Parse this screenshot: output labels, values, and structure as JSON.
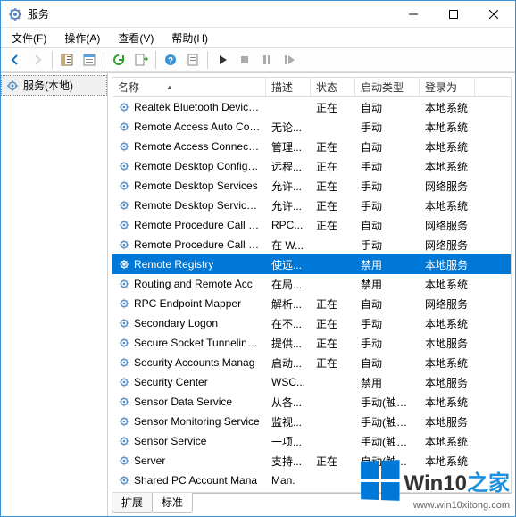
{
  "title": "服务",
  "menus": {
    "file": "文件(F)",
    "action": "操作(A)",
    "view": "查看(V)",
    "help": "帮助(H)"
  },
  "tree": {
    "root": "服务(本地)"
  },
  "columns": {
    "name": "名称",
    "desc": "描述",
    "status": "状态",
    "start": "启动类型",
    "logon": "登录为"
  },
  "tabs": {
    "extended": "扩展",
    "standard": "标准"
  },
  "watermark": {
    "brand_main": "Win10",
    "brand_suffix": "之家",
    "url": "www.win10xitong.com"
  },
  "services": [
    {
      "name": "Realtek Bluetooth Device...",
      "desc": "",
      "status": "正在",
      "start": "自动",
      "logon": "本地系统"
    },
    {
      "name": "Remote Access Auto Con...",
      "desc": "无论...",
      "status": "",
      "start": "手动",
      "logon": "本地系统"
    },
    {
      "name": "Remote Access Connecti...",
      "desc": "管理...",
      "status": "正在",
      "start": "自动",
      "logon": "本地系统"
    },
    {
      "name": "Remote Desktop Configu...",
      "desc": "远程...",
      "status": "正在",
      "start": "手动",
      "logon": "本地系统"
    },
    {
      "name": "Remote Desktop Services",
      "desc": "允许...",
      "status": "正在",
      "start": "手动",
      "logon": "网络服务"
    },
    {
      "name": "Remote Desktop Service...",
      "desc": "允许...",
      "status": "正在",
      "start": "手动",
      "logon": "本地系统"
    },
    {
      "name": "Remote Procedure Call (...",
      "desc": "RPC...",
      "status": "正在",
      "start": "自动",
      "logon": "网络服务"
    },
    {
      "name": "Remote Procedure Call (...",
      "desc": "在 W...",
      "status": "",
      "start": "手动",
      "logon": "网络服务"
    },
    {
      "name": "Remote Registry",
      "desc": "使远...",
      "status": "",
      "start": "禁用",
      "logon": "本地服务",
      "selected": true
    },
    {
      "name": "Routing and Remote Acc",
      "desc": "在局...",
      "status": "",
      "start": "禁用",
      "logon": "本地系统"
    },
    {
      "name": "RPC Endpoint Mapper",
      "desc": "解析...",
      "status": "正在",
      "start": "自动",
      "logon": "网络服务"
    },
    {
      "name": "Secondary Logon",
      "desc": "在不...",
      "status": "正在",
      "start": "手动",
      "logon": "本地系统"
    },
    {
      "name": "Secure Socket Tunneling ...",
      "desc": "提供...",
      "status": "正在",
      "start": "手动",
      "logon": "本地服务"
    },
    {
      "name": "Security Accounts Manag",
      "desc": "启动...",
      "status": "正在",
      "start": "自动",
      "logon": "本地系统"
    },
    {
      "name": "Security Center",
      "desc": "WSC...",
      "status": "",
      "start": "禁用",
      "logon": "本地服务"
    },
    {
      "name": "Sensor Data Service",
      "desc": "从各...",
      "status": "",
      "start": "手动(触发...",
      "logon": "本地系统"
    },
    {
      "name": "Sensor Monitoring Service",
      "desc": "监视...",
      "status": "",
      "start": "手动(触发...",
      "logon": "本地服务"
    },
    {
      "name": "Sensor Service",
      "desc": "一项...",
      "status": "",
      "start": "手动(触发...",
      "logon": "本地系统"
    },
    {
      "name": "Server",
      "desc": "支持...",
      "status": "正在",
      "start": "自动(触发...",
      "logon": "本地系统"
    },
    {
      "name": "Shared PC Account Mana",
      "desc": "Man.",
      "status": "",
      "start": "",
      "logon": ""
    }
  ]
}
